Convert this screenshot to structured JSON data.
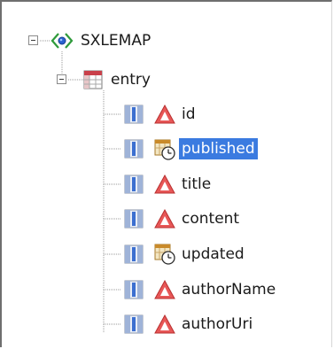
{
  "tree": {
    "root": {
      "label": "SXLEMAP",
      "icon": "map-root-icon",
      "expanded": true
    },
    "entry": {
      "label": "entry",
      "icon": "table-icon",
      "expanded": true
    },
    "children": [
      {
        "label": "id",
        "icon": "character-type-icon",
        "column_icon": "column-icon",
        "selected": false
      },
      {
        "label": "published",
        "icon": "datetime-type-icon",
        "column_icon": "column-icon",
        "selected": true
      },
      {
        "label": "title",
        "icon": "character-type-icon",
        "column_icon": "column-icon",
        "selected": false
      },
      {
        "label": "content",
        "icon": "character-type-icon",
        "column_icon": "column-icon",
        "selected": false
      },
      {
        "label": "updated",
        "icon": "datetime-type-icon",
        "column_icon": "column-icon",
        "selected": false
      },
      {
        "label": "authorName",
        "icon": "character-type-icon",
        "column_icon": "column-icon",
        "selected": false
      },
      {
        "label": "authorUri",
        "icon": "character-type-icon",
        "column_icon": "column-icon",
        "selected": false
      }
    ]
  },
  "colors": {
    "selection": "#3b7be0",
    "selection_text": "#ffffff",
    "tree_line": "#9a9a9a",
    "panel_border": "#6f6f6f"
  }
}
